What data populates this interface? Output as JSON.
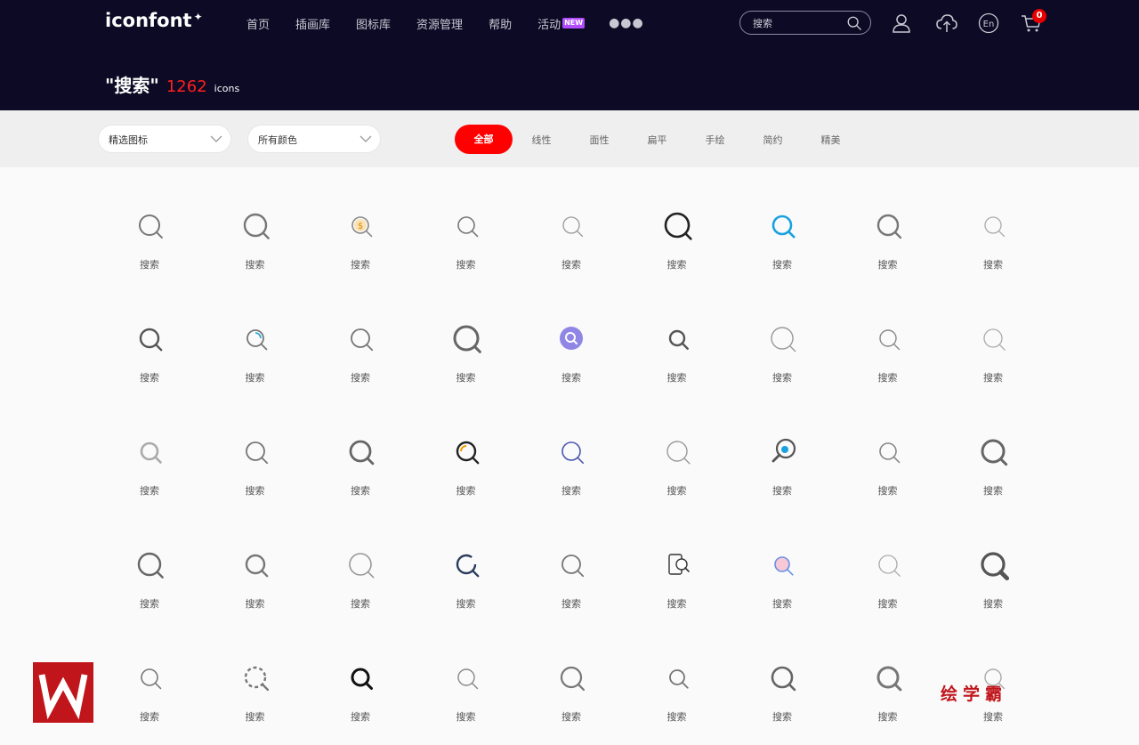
{
  "header": {
    "logo": "iconfont",
    "nav": [
      "首页",
      "插画库",
      "图标库",
      "资源管理",
      "帮助",
      "活动"
    ],
    "new_badge": "NEW",
    "search_placeholder": "搜索",
    "cart_count": "0",
    "language": "En"
  },
  "result": {
    "query": "\"搜索\"",
    "count": "1262",
    "unit": "icons"
  },
  "filters": {
    "icon_select": "精选图标",
    "color_select": "所有颜色",
    "tabs": [
      "全部",
      "线性",
      "面性",
      "扁平",
      "手绘",
      "简约",
      "精美"
    ],
    "active_tab": "全部"
  },
  "icons": {
    "label": "搜索",
    "rows": 5,
    "columns": 9
  },
  "watermark": {
    "brand_text": "绘学霸",
    "logo_letters": "W"
  },
  "colors": {
    "header_bg": "#0c0a24",
    "accent_red": "#ff0000",
    "filter_bg": "#efefef",
    "page_bg": "#fafafa"
  }
}
